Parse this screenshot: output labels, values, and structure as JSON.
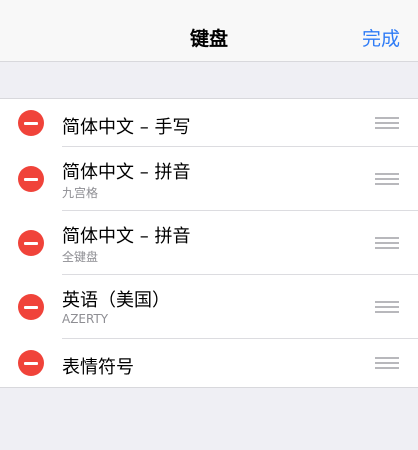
{
  "navbar": {
    "title": "键盘",
    "done_label": "完成"
  },
  "keyboards": [
    {
      "title": "简体中文 – 手写",
      "subtitle": ""
    },
    {
      "title": "简体中文 – 拼音",
      "subtitle": "九宫格"
    },
    {
      "title": "简体中文 – 拼音",
      "subtitle": "全键盘"
    },
    {
      "title": "英语（美国）",
      "subtitle": "AZERTY"
    },
    {
      "title": "表情符号",
      "subtitle": ""
    }
  ],
  "colors": {
    "accent": "#2f7cf6",
    "delete": "#f0433a",
    "background": "#efeff4"
  },
  "icons": {
    "delete": "minus-circle-icon",
    "reorder": "reorder-handle-icon"
  }
}
